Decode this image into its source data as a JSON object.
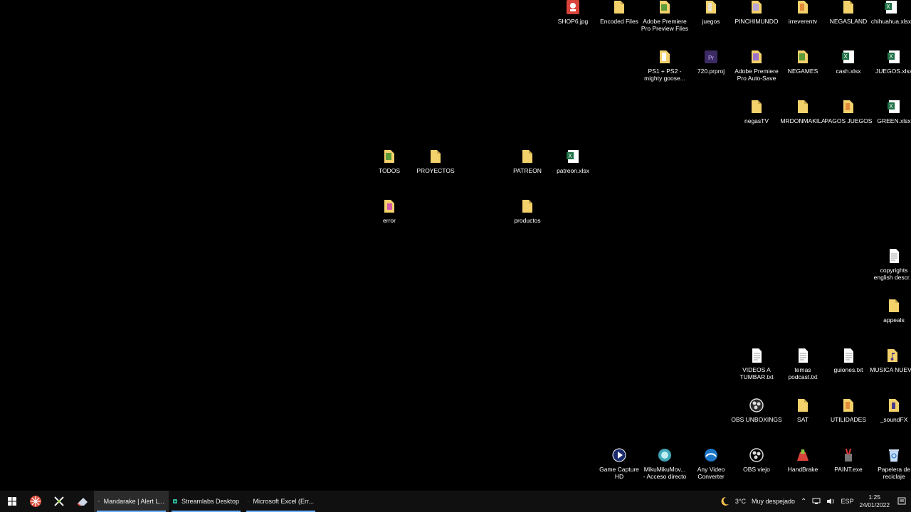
{
  "desktop": {
    "top_row": [
      "SHOP6.jpg",
      "Encoded Files",
      "Adobe Premiere\nPro Preview Files",
      "juegos",
      "PINCHIMUNDO",
      "irreverentv",
      "NEGASLAND",
      "chihuahua.xlsx"
    ],
    "row2": [
      "PS1 + PS2 -\nmighty goose...",
      "720.prproj",
      "Adobe Premiere\nPro Auto-Save",
      "NEGAMES",
      "cash.xlsx",
      "JUEGOS.xlsx"
    ],
    "row3": [
      "negasTV",
      "MRDONMAKILA",
      "PAGOS JUEGOS",
      "GREEN.xlsx"
    ],
    "mid_row": [
      "TODOS",
      "PROYECTOS",
      "PATREON",
      "patreon.xlsx"
    ],
    "mid_row2": [
      "error",
      "productos"
    ],
    "right_col": [
      "copyrights\nenglish descr...",
      "appeals"
    ],
    "row_txt": [
      "VIDEOS A\nTUMBAR.txt",
      "temas\npodcast.txt",
      "guiones.txt",
      "MUSICA NUEVA"
    ],
    "row_obs": [
      "OBS UNBOXINGS",
      "SAT",
      "UTILIDADES",
      "_soundFX"
    ],
    "row_apps": [
      "Game Capture\nHD",
      "MikuMikuMov...\n- Acceso directo",
      "Any Video\nConverter",
      "OBS viejo",
      "HandBrake",
      "PAINT.exe",
      "Papelera de\nreciclaje"
    ]
  },
  "taskbar": {
    "apps": [
      "Mandarake | Alert L...",
      "Streamlabs Desktop",
      "Microsoft Excel (Err..."
    ],
    "weather_temp": "3°C",
    "weather_desc": "Muy despejado",
    "lang": "ESP",
    "time": "1:25",
    "date": "24/01/2022"
  },
  "colors": {
    "folder": "#f3d16b",
    "excel": "#1e7145",
    "taskbar": "#101010",
    "accent": "#6ab0ff"
  }
}
